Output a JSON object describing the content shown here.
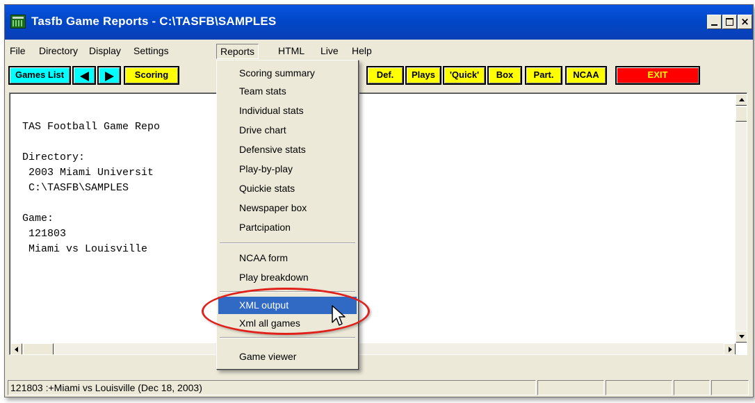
{
  "window": {
    "title": "Tasfb Game Reports - C:\\TASFB\\SAMPLES",
    "caption_buttons": {
      "minimize_icon": "minimize-icon",
      "maximize_icon": "maximize-icon",
      "close_glyph": "×"
    }
  },
  "menubar": {
    "items": [
      "File",
      "Directory",
      "Display",
      "Settings",
      "Reports",
      "HTML",
      "Live",
      "Help"
    ],
    "active": "Reports"
  },
  "toolbar": {
    "games_list": "Games List",
    "prev_icon": "left-arrow-icon",
    "next_icon": "right-arrow-icon",
    "scoring": "Scoring",
    "def": "Def.",
    "plays": "Plays",
    "quick": "'Quick'",
    "box": "Box",
    "part": "Part.",
    "ncaa": "NCAA",
    "exit": "EXIT"
  },
  "report": {
    "heading": "TAS Football Game Repo",
    "directory_label": "Directory:",
    "directory_name": "2003 Miami Universit",
    "directory_path": "C:\\TASFB\\SAMPLES",
    "game_label": "Game:",
    "game_id": "121803",
    "game_name": "Miami vs Louisville"
  },
  "reports_menu": {
    "group1": [
      "Scoring summary",
      "Team stats",
      "Individual stats",
      "Drive chart",
      "Defensive stats",
      "Play-by-play",
      "Quickie stats",
      "Newspaper box",
      "Partcipation"
    ],
    "group2": [
      "NCAA form",
      "Play breakdown"
    ],
    "group3": [
      "XML output",
      "Xml all games"
    ],
    "group4": [
      "Game viewer"
    ],
    "highlighted": "XML output"
  },
  "statusbar": {
    "text": "121803 :+Miami vs Louisville (Dec 18, 2003)"
  },
  "colors": {
    "titlebar": "#0a54e0",
    "toolbar_cyan": "#00ffff",
    "toolbar_yellow": "#ffff00",
    "toolbar_exit": "#ff0000",
    "menu_highlight": "#316ac5",
    "annotation": "#e0201a"
  }
}
